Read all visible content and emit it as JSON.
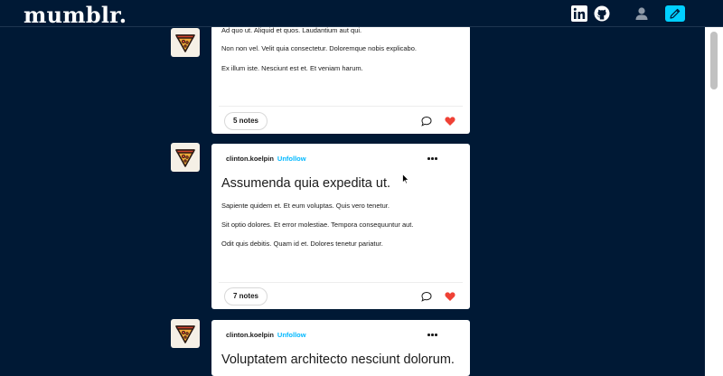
{
  "header": {
    "logo": "mumblr.",
    "icons": [
      "linkedin-icon",
      "github-icon",
      "account-icon",
      "pencil-icon"
    ],
    "accent": "#00cfff",
    "background": "#001935"
  },
  "posts": [
    {
      "blog": "",
      "follow": "",
      "title": "",
      "paragraphs": [
        "Ad quo ut. Aliquid et quos. Laudantium aut qui.",
        "Non non vel. Velit quia consectetur. Doloremque nobis explicabo.",
        "Ex illum iste. Nesciunt est et. Et veniam harum."
      ],
      "notes": "5 notes",
      "liked": true
    },
    {
      "blog": "clinton.koelpin",
      "follow": "Unfollow",
      "title": "Assumenda quia expedita ut.",
      "paragraphs": [
        "Sapiente quidem et. Et eum voluptas. Quis vero tenetur.",
        "Sit optio dolores. Et error molestiae. Tempora consequuntur aut.",
        "Odit quis debitis. Quam id et. Dolores tenetur pariatur."
      ],
      "notes": "7 notes",
      "liked": true
    },
    {
      "blog": "clinton.koelpin",
      "follow": "Unfollow",
      "title": "Voluptatem architecto nesciunt dolorum.",
      "paragraphs": [],
      "notes": "",
      "liked": false
    }
  ],
  "like_color": "#ef4135"
}
